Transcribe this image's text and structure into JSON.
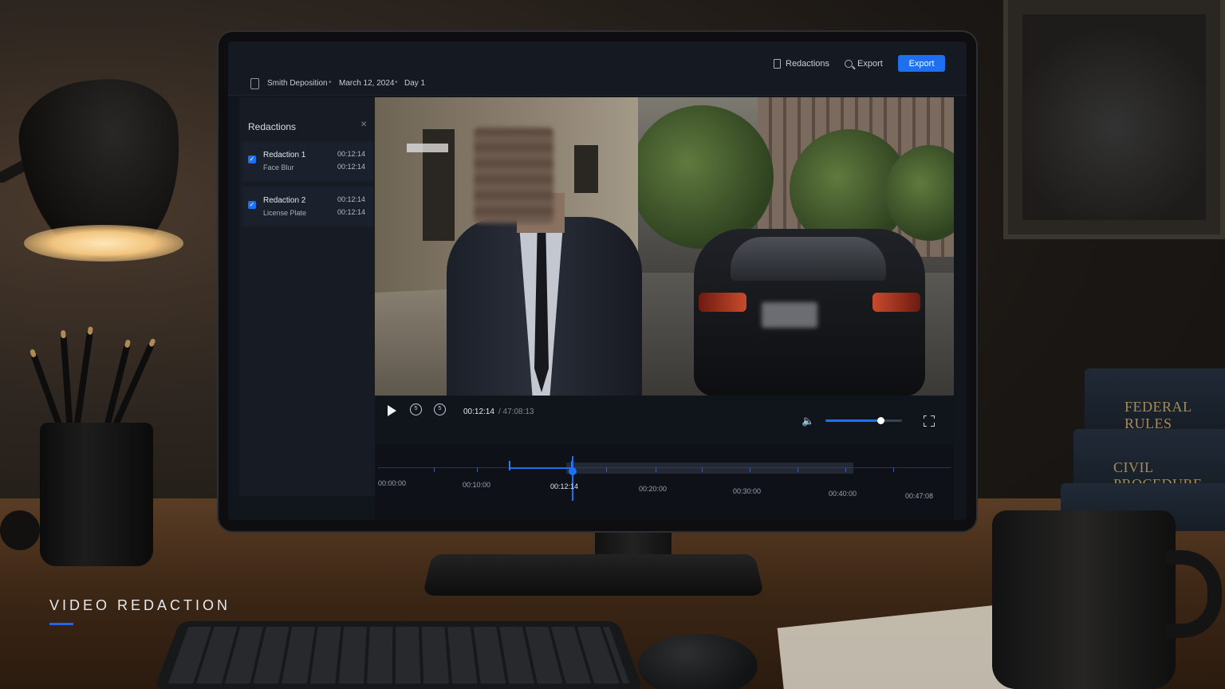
{
  "header": {
    "breadcrumb": {
      "case": "Smith Deposition",
      "separator": "•",
      "date": "March 12, 2024",
      "day": "Day 1"
    },
    "redactions_label": "Redactions",
    "export_link_label": "Export",
    "export_button_label": "Export",
    "accent_color": "#1f6ff2"
  },
  "sidebar": {
    "title": "Redactions",
    "items": [
      {
        "name": "Redaction 1",
        "type": "Face Blur",
        "start": "00:12:14",
        "end": "00:12:14",
        "checked": true
      },
      {
        "name": "Redaction 2",
        "type": "License Plate",
        "start": "00:12:14",
        "end": "00:12:14",
        "checked": true
      }
    ]
  },
  "player": {
    "current_time": "00:12:14",
    "total_time": "/ 47:08:13",
    "volume_level": 0.72
  },
  "timeline": {
    "labels": [
      "00:00:00",
      "00:10:00",
      "00:12:14",
      "00:20:00",
      "00:30:00",
      "00:40:00",
      "00:47:08"
    ],
    "active_label": "00:12:14"
  },
  "scene": {
    "books": [
      "FEDERAL RULES",
      "CIVIL PROCEDURE"
    ],
    "caption": "VIDEO REDACTION"
  }
}
